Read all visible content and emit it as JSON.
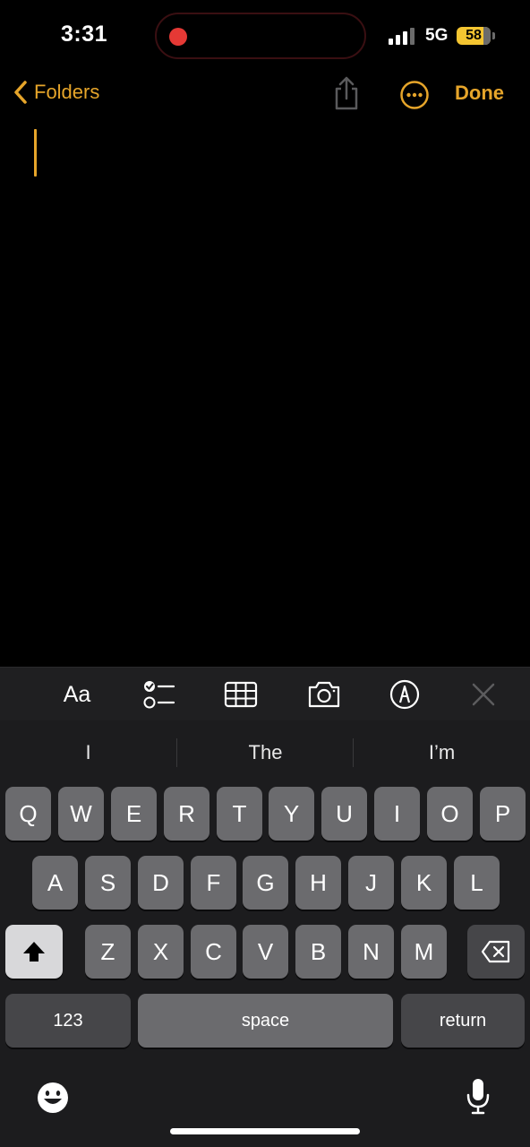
{
  "status": {
    "time": "3:31",
    "network": "5G",
    "battery": "58"
  },
  "nav": {
    "back_label": "Folders",
    "done_label": "Done"
  },
  "toolbar": {
    "format_label": "Aa"
  },
  "predictions": [
    "I",
    "The",
    "I’m"
  ],
  "keyboard": {
    "row1": [
      "Q",
      "W",
      "E",
      "R",
      "T",
      "Y",
      "U",
      "I",
      "O",
      "P"
    ],
    "row2": [
      "A",
      "S",
      "D",
      "F",
      "G",
      "H",
      "J",
      "K",
      "L"
    ],
    "row3": [
      "Z",
      "X",
      "C",
      "V",
      "B",
      "N",
      "M"
    ],
    "numbers_label": "123",
    "space_label": "space",
    "return_label": "return"
  },
  "icons": {
    "back": "chevron-left-icon",
    "share": "share-icon",
    "more": "ellipsis-circle-icon",
    "checklist": "checklist-icon",
    "table": "table-icon",
    "camera": "camera-icon",
    "markup": "markup-pen-icon",
    "close": "close-icon",
    "shift": "shift-icon",
    "delete": "delete-icon",
    "emoji": "emoji-icon",
    "mic": "microphone-icon"
  },
  "colors": {
    "accent": "#e6a52a",
    "record": "#e53935",
    "battery": "#f4c531",
    "key": "#6b6b6e",
    "key_dark": "#464649"
  }
}
